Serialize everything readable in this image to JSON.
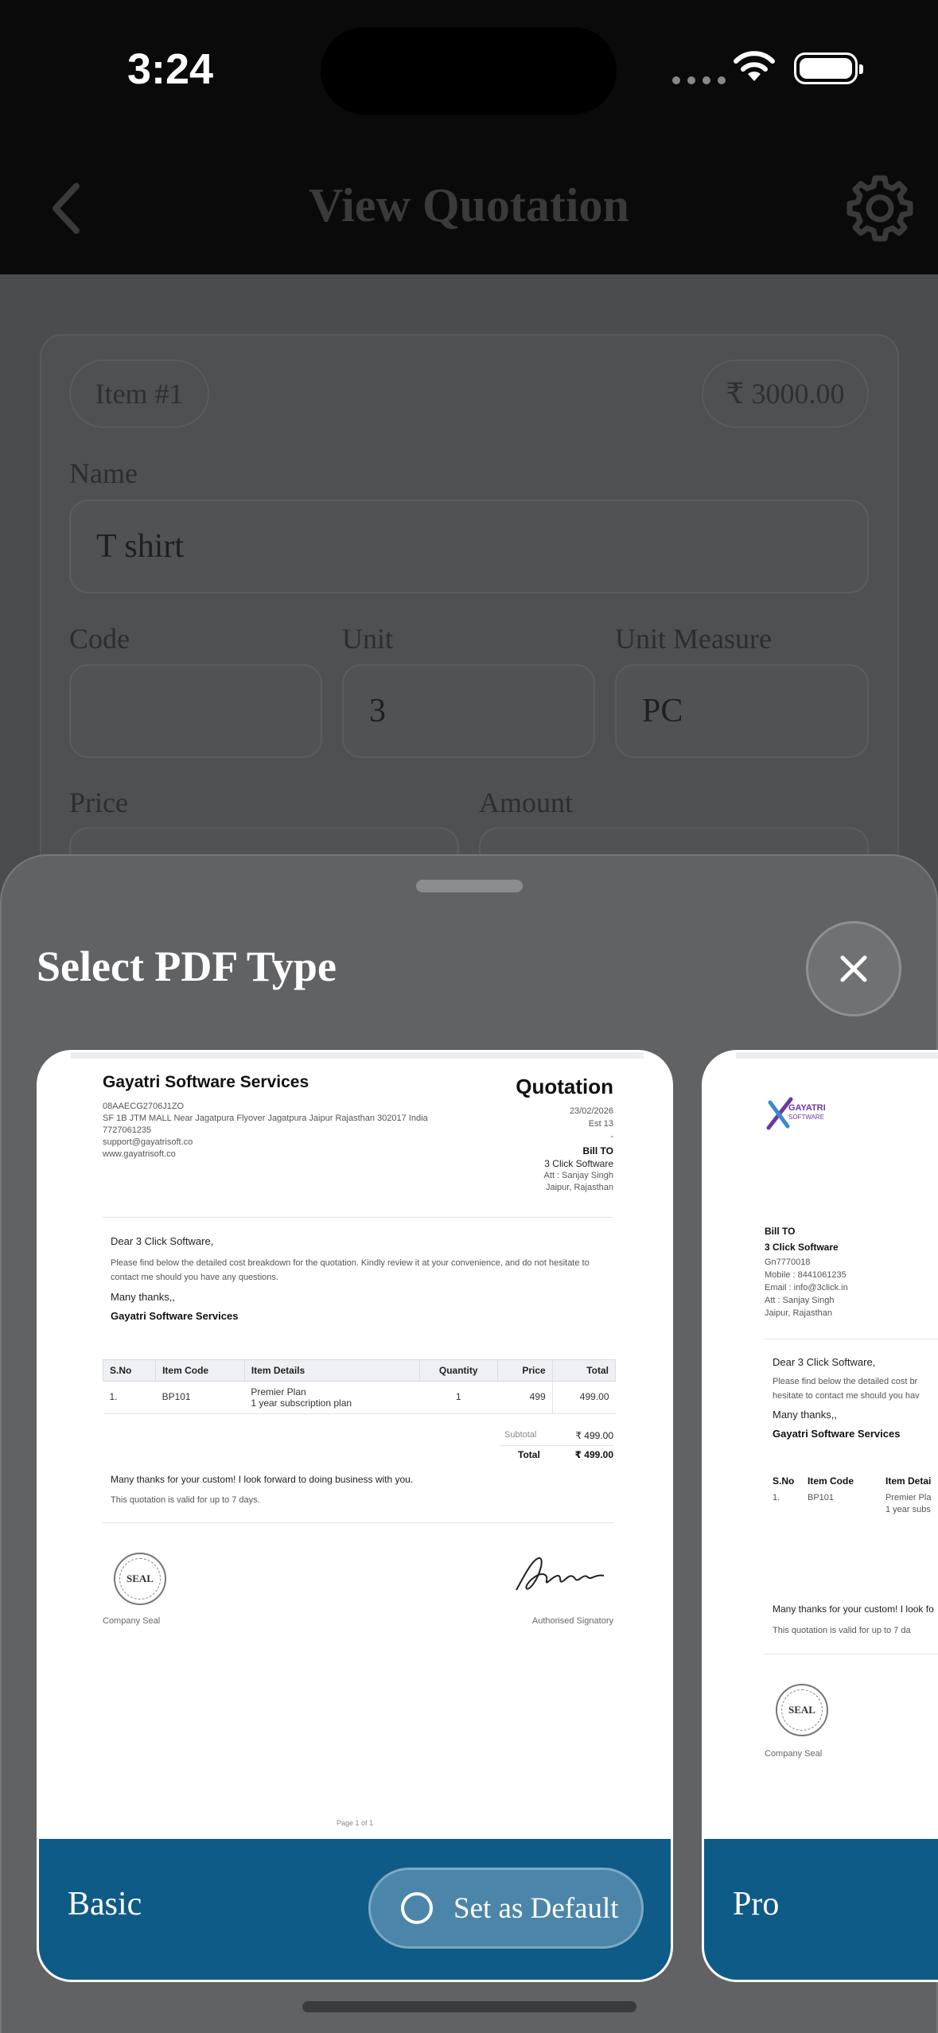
{
  "status": {
    "time": "3:24"
  },
  "appbar": {
    "title": "View Quotation"
  },
  "item": {
    "number": "Item #1",
    "total": "₹ 3000.00",
    "name_label": "Name",
    "name_value": "T shirt",
    "code_label": "Code",
    "code_value": "",
    "unit_label": "Unit",
    "unit_value": "3",
    "measure_label": "Unit Measure",
    "measure_value": "PC",
    "price_label": "Price",
    "amount_label": "Amount"
  },
  "sheet": {
    "title": "Select PDF Type",
    "cards": [
      {
        "name": "Basic",
        "default_label": "Set as Default"
      },
      {
        "name": "Pro"
      }
    ]
  },
  "basic_doc": {
    "company": "Gayatri Software Services",
    "gst": "08AAECG2706J1ZO",
    "address": "SF 1B JTM MALL Near Jagatpura Flyover Jagatpura Jaipur Rajasthan 302017 India",
    "phone": "7727061235",
    "email": "support@gayatrisoft.co",
    "website": "www.gayatrisoft.co",
    "doc_title": "Quotation",
    "date": "23/02/2026",
    "est": "Est 13",
    "dash": "-",
    "bill_to_label": "Bill TO",
    "bill_to_name": "3 Click Software",
    "attn": "Att : Sanjay Singh",
    "location": "Jaipur, Rajasthan",
    "greeting": "Dear 3 Click Software,",
    "intro": "Please find below the detailed cost breakdown for the quotation. Kindly review it at your convenience, and do not hesitate to contact me should you have any questions.",
    "thanks": "Many thanks,,",
    "signoff": "Gayatri Software Services",
    "table_headers": [
      "S.No",
      "Item Code",
      "Item Details",
      "Quantity",
      "Price",
      "Total"
    ],
    "rows": [
      {
        "sno": "1.",
        "code": "BP101",
        "details": "Premier Plan",
        "details2": "1 year subscription plan",
        "qty": "1",
        "price": "499",
        "total": "499.00"
      }
    ],
    "subtotal_label": "Subtotal",
    "subtotal": "₹ 499.00",
    "total_label": "Total",
    "total": "₹ 499.00",
    "closing": "Many thanks for your custom! I look forward to doing business with you.",
    "validity": "This quotation is valid for up to 7 days.",
    "seal_text": "SEAL",
    "seal_label": "Company Seal",
    "signatory_label": "Authorised Signatory",
    "page": "Page 1 of 1"
  },
  "pro_doc": {
    "logo_text": "GAYATRI",
    "logo_sub": "SOFTWARE",
    "bill_to_label": "Bill TO",
    "bill_to_name": "3 Click Software",
    "gst": "Gn7770018",
    "mobile": "Mobile : 8441061235",
    "email": "Email : info@3click.in",
    "attn": "Att : Sanjay Singh",
    "location": "Jaipur, Rajasthan",
    "greeting": "Dear 3 Click Software,",
    "intro1": "Please find below the detailed cost br",
    "intro2": "hesitate to contact me should you hav",
    "thanks": "Many thanks,,",
    "signoff": "Gayatri Software Services",
    "h_sno": "S.No",
    "h_code": "Item Code",
    "h_details": "Item Detai",
    "row_sno": "1.",
    "row_code": "BP101",
    "row_details": "Premier Pla",
    "row_details2": "1 year subs",
    "closing": "Many thanks for your custom! I look fo",
    "validity": "This quotation is valid for up to 7 da",
    "seal_text": "SEAL",
    "seal_label": "Company Seal"
  }
}
